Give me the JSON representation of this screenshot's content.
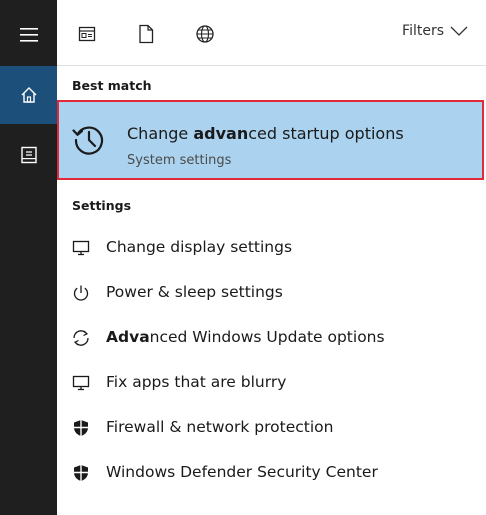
{
  "sidebar": {
    "items": [
      {
        "name": "hamburger-menu",
        "icon": "hamburger-icon"
      },
      {
        "name": "home",
        "icon": "home-icon",
        "active": true
      },
      {
        "name": "documents",
        "icon": "document-icon"
      }
    ]
  },
  "toolbar": {
    "filters_label": "Filters",
    "icons": [
      "apps-icon",
      "document-icon",
      "globe-icon"
    ]
  },
  "best_match": {
    "heading": "Best match",
    "title_prefix": "Change ",
    "title_bold": "advan",
    "title_suffix": "ced startup options",
    "subtitle": "System settings",
    "icon": "history-icon",
    "highlight_color": "#abd3ef",
    "border_color": "#e02a3a"
  },
  "settings": {
    "heading": "Settings",
    "items": [
      {
        "icon": "monitor-icon",
        "prefix": "Change display settings",
        "bold": "",
        "suffix": ""
      },
      {
        "icon": "power-icon",
        "prefix": "Power & sleep settings",
        "bold": "",
        "suffix": ""
      },
      {
        "icon": "sync-icon",
        "prefix": "",
        "bold": "Adva",
        "suffix": "nced Windows Update options"
      },
      {
        "icon": "monitor-icon",
        "prefix": "Fix apps that are blurry",
        "bold": "",
        "suffix": ""
      },
      {
        "icon": "shield-icon",
        "prefix": "Firewall & network protection",
        "bold": "",
        "suffix": ""
      },
      {
        "icon": "shield-icon",
        "prefix": "Windows Defender Security Center",
        "bold": "",
        "suffix": ""
      }
    ]
  }
}
